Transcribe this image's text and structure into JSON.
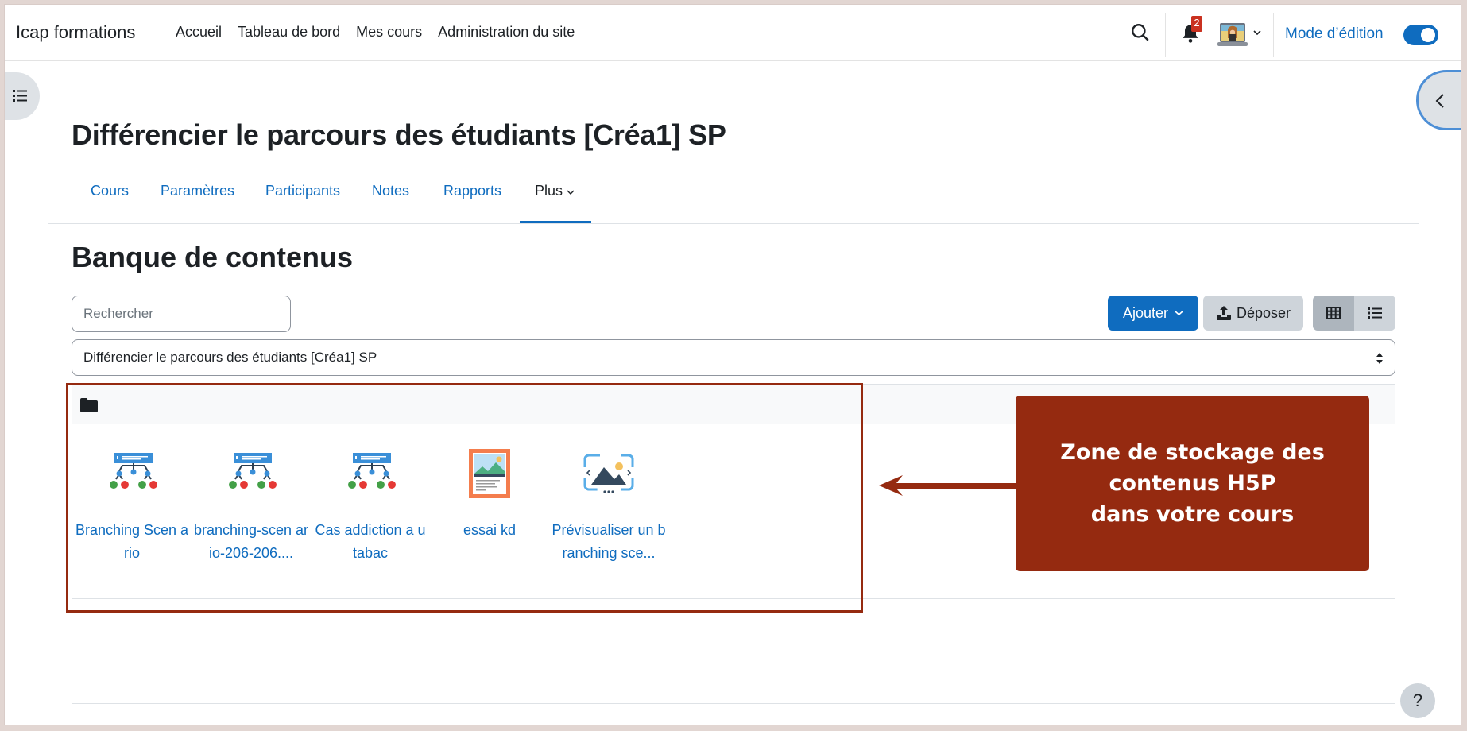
{
  "navbar": {
    "brand": "Icap formations",
    "links": [
      "Accueil",
      "Tableau de bord",
      "Mes cours",
      "Administration du site"
    ],
    "notification_count": "2",
    "edit_mode_label": "Mode d’édition",
    "edit_mode_on": true
  },
  "course": {
    "title": "Différencier le parcours des étudiants [Créa1] SP",
    "tabs": [
      "Cours",
      "Paramètres",
      "Participants",
      "Notes",
      "Rapports",
      "Plus"
    ],
    "active_tab": "Plus"
  },
  "content_bank": {
    "title": "Banque de contenus",
    "search_placeholder": "Rechercher",
    "add_label": "Ajouter",
    "upload_label": "Déposer",
    "view_mode": "grid",
    "context_selected": "Différencier le parcours des étudiants [Créa1] SP",
    "items": [
      {
        "label": "Branching Scenario",
        "display": "Branching Scen ario",
        "icon": "branching-scenario-icon"
      },
      {
        "label": "branching-scenario-206-206....",
        "display": "branching-scen ario-206-206....",
        "icon": "branching-scenario-icon"
      },
      {
        "label": "Cas addiction au tabac",
        "display": "Cas addiction a u tabac",
        "icon": "branching-scenario-icon"
      },
      {
        "label": "essai kd",
        "display": "essai kd",
        "icon": "image-card-icon"
      },
      {
        "label": "Prévisualiser un branching sce...",
        "display": "Prévisualiser un branching sce...",
        "icon": "image-slider-icon"
      }
    ]
  },
  "annotation": {
    "text": "Zone de stockage des\ncontenus H5P\ndans votre cours",
    "color": "#952a10"
  },
  "help_label": "?",
  "colors": {
    "primary": "#0f6cbf",
    "annotation": "#952a10",
    "badge": "#ca3120"
  }
}
